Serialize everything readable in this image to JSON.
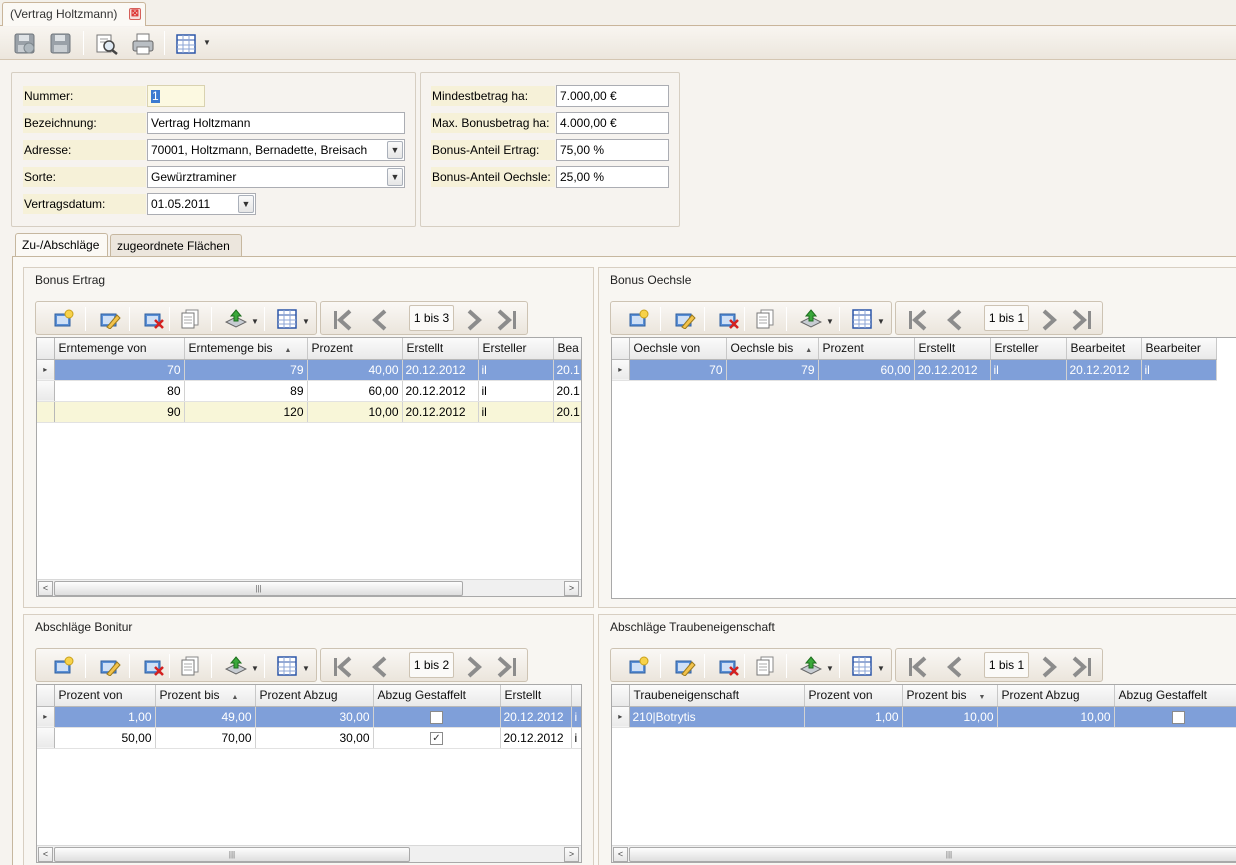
{
  "document_tab": {
    "title": "(Vertrag Holtzmann)",
    "close_glyph": "⊠"
  },
  "toolbar": {
    "icons": [
      "save-close-icon",
      "save-icon",
      "print-preview-icon",
      "print-icon",
      "layout-grid-icon"
    ]
  },
  "form": {
    "nummer": {
      "label": "Nummer:",
      "value": "1"
    },
    "bezeichnung": {
      "label": "Bezeichnung:",
      "value": "Vertrag Holtzmann"
    },
    "adresse": {
      "label": "Adresse:",
      "value": "70001, Holtzmann, Bernadette, Breisach"
    },
    "sorte": {
      "label": "Sorte:",
      "value": "Gewürztraminer"
    },
    "vertragsdatum": {
      "label": "Vertragsdatum:",
      "value": "01.05.2011"
    },
    "mindestbetrag": {
      "label": "Mindestbetrag ha:",
      "value": "7.000,00 €"
    },
    "max_bonus": {
      "label": "Max. Bonusbetrag ha:",
      "value": "4.000,00 €"
    },
    "bonus_ertrag": {
      "label": "Bonus-Anteil Ertrag:",
      "value": "75,00 %"
    },
    "bonus_oechsle": {
      "label": "Bonus-Anteil Oechsle:",
      "value": "25,00 %"
    }
  },
  "tabs": [
    {
      "label": "Zu-/Abschläge",
      "active": true
    },
    {
      "label": "zugeordnete Flächen",
      "active": false
    }
  ],
  "groups": {
    "bonus_ertrag": {
      "title": "Bonus Ertrag",
      "pager": "1 bis 3",
      "columns": [
        "Erntemenge von",
        "Erntemenge bis",
        "Prozent",
        "Erstellt",
        "Ersteller",
        "Bea"
      ],
      "rows": [
        [
          "70",
          "79",
          "40,00",
          "20.12.2012",
          "il",
          "20.1"
        ],
        [
          "80",
          "89",
          "60,00",
          "20.12.2012",
          "il",
          "20.1"
        ],
        [
          "90",
          "120",
          "10,00",
          "20.12.2012",
          "il",
          "20.1"
        ]
      ]
    },
    "bonus_oechsle": {
      "title": "Bonus Oechsle",
      "pager": "1 bis 1",
      "columns": [
        "Oechsle von",
        "Oechsle bis",
        "Prozent",
        "Erstellt",
        "Ersteller",
        "Bearbeitet",
        "Bearbeiter"
      ],
      "rows": [
        [
          "70",
          "79",
          "60,00",
          "20.12.2012",
          "il",
          "20.12.2012",
          "il"
        ]
      ]
    },
    "abschlaege_bonitur": {
      "title": "Abschläge Bonitur",
      "pager": "1 bis 2",
      "columns": [
        "Prozent von",
        "Prozent bis",
        "Prozent Abzug",
        "Abzug Gestaffelt",
        "Erstellt",
        ""
      ],
      "rows": [
        [
          "1,00",
          "49,00",
          "30,00",
          "",
          "20.12.2012",
          "i"
        ],
        [
          "50,00",
          "70,00",
          "30,00",
          "✓",
          "20.12.2012",
          "i"
        ]
      ]
    },
    "abschlaege_traube": {
      "title": "Abschläge Traubeneigenschaft",
      "pager": "1 bis 1",
      "columns": [
        "Traubeneigenschaft",
        "Prozent von",
        "Prozent bis",
        "Prozent Abzug",
        "Abzug Gestaffelt"
      ],
      "rows": [
        [
          "210|Botrytis",
          "1,00",
          "10,00",
          "10,00",
          ""
        ]
      ]
    }
  },
  "glyphs": {
    "scroll_left": "<",
    "scroll_right": ">",
    "thumb_grip": "|||",
    "dropdown": "▼",
    "row_pointer": "▸",
    "sort_asc": "▲",
    "sort_desc": "▼"
  }
}
